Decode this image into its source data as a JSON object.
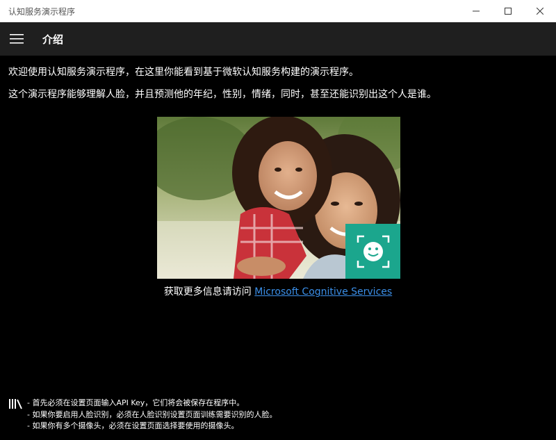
{
  "window": {
    "title": "认知服务演示程序",
    "controls": {
      "minimize": "—",
      "maximize": "☐",
      "close": "✕"
    }
  },
  "nav": {
    "menu_icon": "hamburger-icon",
    "page_title": "介绍"
  },
  "main": {
    "intro_line_1": "欢迎使用认知服务演示程序，在这里你能看到基于微软认知服务构建的演示程序。",
    "intro_line_2": "这个演示程序能够理解人脸，并且预测他的年纪，性别，情绪，同时，甚至还能识别出这个人是谁。",
    "hero_image": "photo-of-mother-and-daughter-smiling",
    "badge_icon": "smiley-face-scan-icon",
    "more_info_prefix": "获取更多信息请访问 ",
    "more_info_link": "Microsoft Cognitive Services"
  },
  "footer": {
    "icon": "library-books-icon",
    "notes": [
      "- 首先必须在设置页面输入API Key，它们将会被保存在程序中。",
      "- 如果你要启用人脸识别，必须在人脸识别设置页面训练需要识别的人脸。",
      "- 如果你有多个摄像头，必须在设置页面选择要使用的摄像头。"
    ]
  },
  "colors": {
    "background": "#000000",
    "nav_bar": "#1f1f1f",
    "accent_badge": "#1ba68d",
    "link": "#3b8fe8"
  }
}
